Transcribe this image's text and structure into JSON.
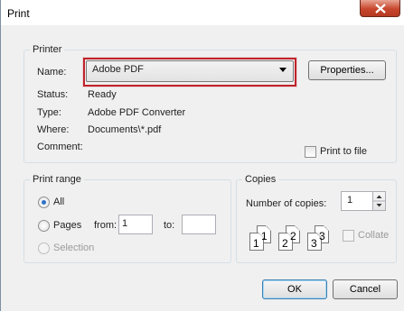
{
  "window": {
    "title": "Print"
  },
  "printer": {
    "legend": "Printer",
    "name_label": "Name:",
    "name_value": "Adobe PDF",
    "properties_label": "Properties...",
    "status_label": "Status:",
    "status_value": "Ready",
    "type_label": "Type:",
    "type_value": "Adobe PDF Converter",
    "where_label": "Where:",
    "where_value": "Documents\\*.pdf",
    "comment_label": "Comment:",
    "print_to_file_label": "Print to file"
  },
  "print_range": {
    "legend": "Print range",
    "all_label": "All",
    "pages_label": "Pages",
    "from_label": "from:",
    "from_value": "1",
    "to_label": "to:",
    "to_value": "",
    "selection_label": "Selection"
  },
  "copies": {
    "legend": "Copies",
    "number_label": "Number of copies:",
    "number_value": "1",
    "collate_label": "Collate",
    "collate_pages": [
      "1",
      "1",
      "2",
      "2",
      "3",
      "3"
    ]
  },
  "buttons": {
    "ok_label": "OK",
    "cancel_label": "Cancel"
  },
  "colors": {
    "highlight": "#c0222a",
    "close_button": "#c7462d"
  }
}
